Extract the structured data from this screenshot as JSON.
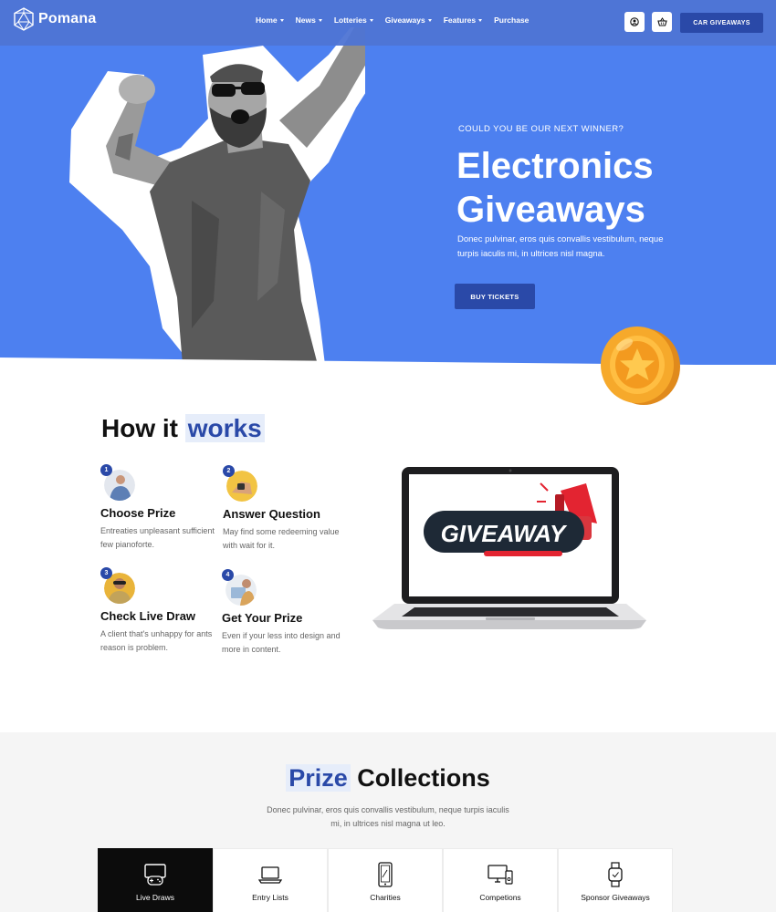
{
  "brand": {
    "name": "Pomana",
    "logo_icon": "geodesic-logo-icon"
  },
  "nav": {
    "items": [
      {
        "label": "Home",
        "has_dropdown": true
      },
      {
        "label": "News",
        "has_dropdown": true
      },
      {
        "label": "Lotteries",
        "has_dropdown": true
      },
      {
        "label": "Giveaways",
        "has_dropdown": true
      },
      {
        "label": "Features",
        "has_dropdown": true
      },
      {
        "label": "Purchase",
        "has_dropdown": false
      }
    ],
    "account_icon": "user-icon",
    "cart_icon": "basket-icon",
    "cta_label": "CAR GIVEAWAYS"
  },
  "hero": {
    "kicker": "COULD YOU BE OUR NEXT WINNER?",
    "title_line1": "Electronics",
    "title_line2": "Giveaways",
    "description": "Donec pulvinar, eros quis convallis vestibulum, neque turpis iaculis mi, in ultrices nisl magna.",
    "button_label": "BUY TICKETS",
    "coin_icon": "star-coin-icon"
  },
  "how": {
    "title_plain": "How it",
    "title_highlight": "works",
    "steps": [
      {
        "num": "1",
        "title": "Choose Prize",
        "desc": "Entreaties unpleasant sufficient few pianoforte."
      },
      {
        "num": "2",
        "title": "Answer Question",
        "desc": "May find some redeeming value with wait for it."
      },
      {
        "num": "3",
        "title": "Check Live Draw",
        "desc": "A client that's unhappy for ants reason is problem."
      },
      {
        "num": "4",
        "title": "Get Your Prize",
        "desc": "Even if your less into design and more in content."
      }
    ],
    "laptop_screen_text": "GIVEAWAY"
  },
  "prizes": {
    "title_highlight": "Prize",
    "title_plain": "Collections",
    "description": "Donec pulvinar, eros quis convallis vestibulum, neque turpis iaculis mi, in ultrices nisl magna ut leo.",
    "categories": [
      {
        "label": "Live Draws",
        "icon": "tv-gamepad-icon",
        "active": true
      },
      {
        "label": "Entry Lists",
        "icon": "laptop-icon",
        "active": false
      },
      {
        "label": "Charities",
        "icon": "phone-icon",
        "active": false
      },
      {
        "label": "Competions",
        "icon": "desktop-icon",
        "active": false
      },
      {
        "label": "Sponsor Giveaways",
        "icon": "smartwatch-icon",
        "active": false
      }
    ]
  },
  "colors": {
    "hero_bg": "#4d80f0",
    "accent": "#2a49a8",
    "highlight_bg": "#e6edfa",
    "section_bg": "#f5f5f5",
    "active_tab": "#0c0c0c"
  }
}
